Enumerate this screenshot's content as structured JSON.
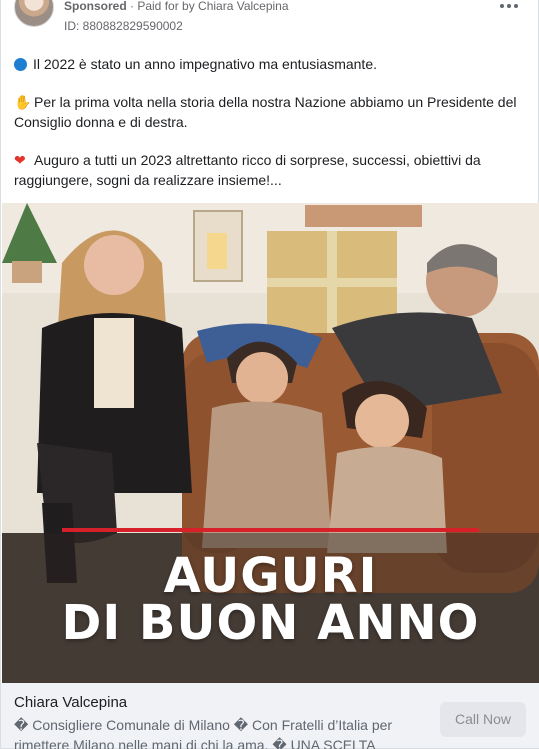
{
  "header": {
    "sponsored_label": "Sponsored",
    "paid_for": " · Paid for by Chiara Valcepina",
    "ad_id": "ID: 880882829590002",
    "more_icon": "ellipsis-icon"
  },
  "body": {
    "paragraphs": [
      {
        "icon": "blue-circle-icon",
        "text": "Il 2022 è stato un anno impegnativo ma entusiasmante."
      },
      {
        "icon": "flexed-biceps-icon",
        "text": "Per la prima volta nella storia della nostra Nazione abbiamo un Presidente del Consiglio donna e di destra."
      },
      {
        "icon": "red-heart-icon",
        "text": "Auguro a tutti un 2023 altrettanto ricco di sorprese, successi, obiettivi da raggiungere, sogni da realizzare insieme!..."
      }
    ]
  },
  "image": {
    "title_line1": "AUGURI",
    "title_line2": "DI BUON ANNO",
    "accent_line_color": "#d6212b"
  },
  "footer": {
    "page_name": "Chiara Valcepina",
    "description": "� Consigliere Comunale di Milano � Con Fratelli d’Italia per rimettere Milano nelle mani di chi la ama. � UNA SCELTA CHIAR…",
    "cta_label": "Call Now"
  },
  "colors": {
    "text": "#1c1e21",
    "secondary": "#65676b",
    "footer_bg": "#f0f2f5",
    "button_bg": "#e4e6eb"
  }
}
